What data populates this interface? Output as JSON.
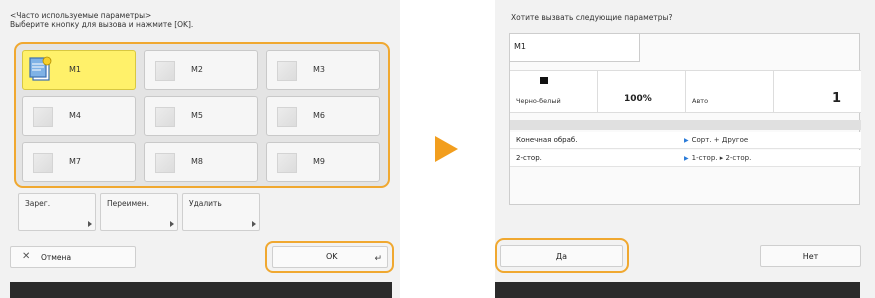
{
  "left": {
    "header_line1": "<Часто используемые параметры>",
    "header_line2": "Выберите кнопку для вызова и нажмите [OK].",
    "memory_buttons": [
      {
        "label": "M1",
        "selected": true
      },
      {
        "label": "M2",
        "selected": false
      },
      {
        "label": "M3",
        "selected": false
      },
      {
        "label": "M4",
        "selected": false
      },
      {
        "label": "M5",
        "selected": false
      },
      {
        "label": "M6",
        "selected": false
      },
      {
        "label": "M7",
        "selected": false
      },
      {
        "label": "M8",
        "selected": false
      },
      {
        "label": "M9",
        "selected": false
      }
    ],
    "function_buttons": [
      {
        "label": "Зарег."
      },
      {
        "label": "Переимен."
      },
      {
        "label": "Удалить"
      }
    ],
    "cancel_label": "Отмена",
    "ok_label": "OK"
  },
  "right": {
    "header": "Хотите вызвать следующие параметры?",
    "memory_name": "M1",
    "color_mode": "Черно-белый",
    "zoom": "100%",
    "paper": "Авто",
    "copies": "1",
    "options": [
      {
        "name": "Конечная обраб.",
        "value": "Сорт. + Другое"
      },
      {
        "name": "2-стор.",
        "value": "1-стор. ▸ 2-стор."
      }
    ],
    "yes_label": "Да",
    "no_label": "Нет"
  },
  "colors": {
    "highlight": "#f0a830",
    "selected_fill": "#fff16a",
    "arrow": "#f29e1e"
  }
}
